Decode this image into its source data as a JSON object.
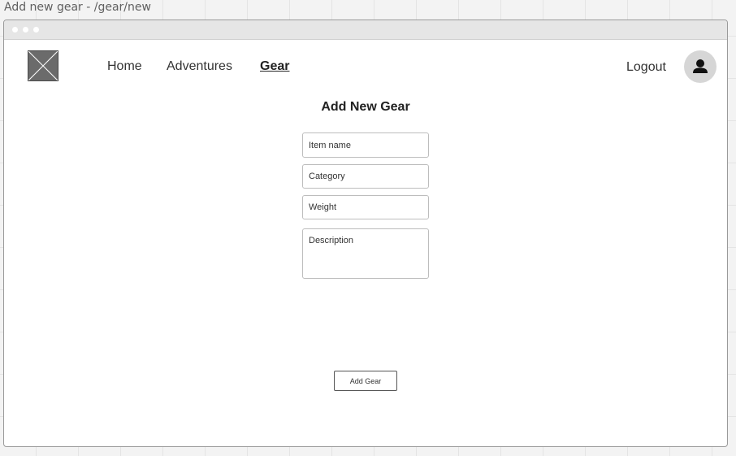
{
  "page": {
    "caption": "Add new gear - /gear/new"
  },
  "icons": {
    "logo": "image-placeholder-icon",
    "avatar": "user-icon"
  },
  "colors": {
    "window_bar": "#e6e6e6",
    "logo_fill": "#6b6b6b",
    "avatar_bg": "#d6d6d6",
    "text": "#333333"
  },
  "nav": {
    "home": "Home",
    "adventures": "Adventures",
    "gear": "Gear",
    "active": "Gear",
    "logout": "Logout"
  },
  "form": {
    "title": "Add New Gear",
    "item_name_placeholder": "Item name",
    "category_placeholder": "Category",
    "weight_placeholder": "Weight",
    "description_placeholder": "Description",
    "submit_label": "Add Gear"
  }
}
